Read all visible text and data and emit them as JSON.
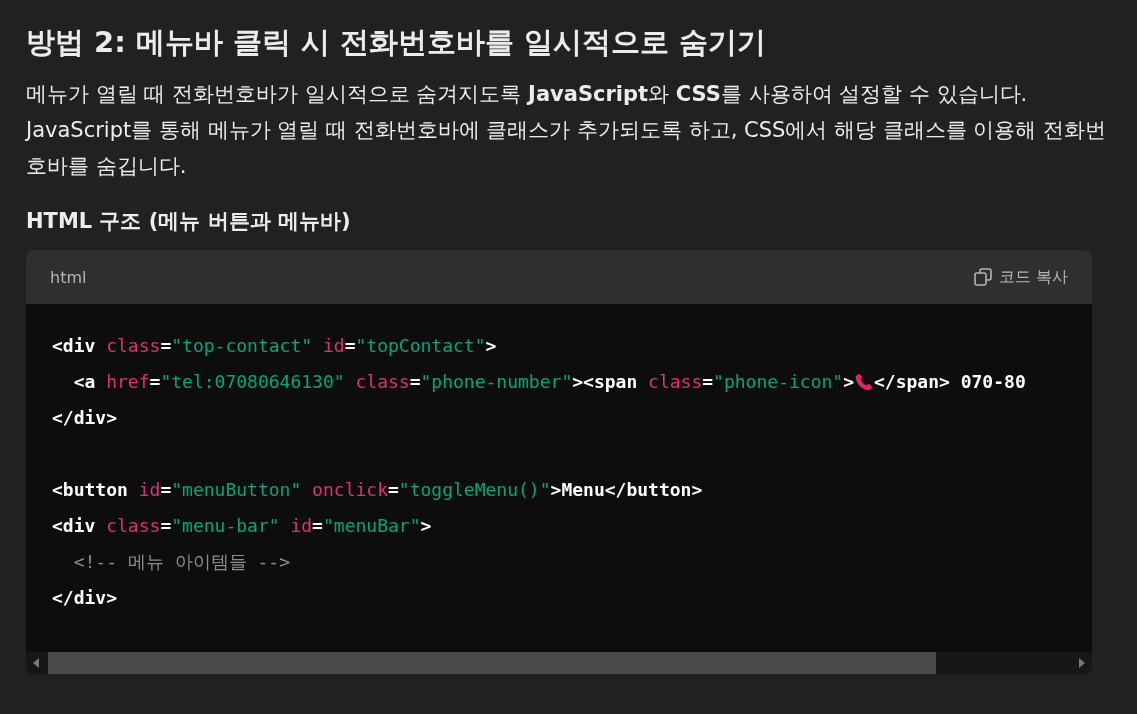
{
  "heading": "방법 2: 메뉴바 클릭 시 전화번호바를 일시적으로 숨기기",
  "paragraph": "메뉴가 열릴 때 전화번호바가 일시적으로 숨겨지도록 **JavaScript**와 **CSS**를 사용하여 설정할 수 있습니다. JavaScript를 통해 메뉴가 열릴 때 전화번호바에 클래스가 추가되도록 하고, CSS에서 해당 클래스를 이용해 전화번호바를 숨깁니다.",
  "subheading": "HTML 구조 (메뉴 버튼과 메뉴바)",
  "code_block": {
    "language": "html",
    "copy_label": "코드 복사",
    "lines": [
      {
        "kind": "code",
        "tokens": [
          {
            "kind": "tag",
            "text": "<div "
          },
          {
            "kind": "attr",
            "text": "class"
          },
          {
            "kind": "tag",
            "text": "="
          },
          {
            "kind": "str",
            "text": "\"top-contact\""
          },
          {
            "kind": "attr",
            "text": " id"
          },
          {
            "kind": "tag",
            "text": "="
          },
          {
            "kind": "str",
            "text": "\"topContact\""
          },
          {
            "kind": "tag",
            "text": ">"
          }
        ]
      },
      {
        "kind": "code",
        "tokens": [
          {
            "kind": "tag",
            "text": "  <a "
          },
          {
            "kind": "attr",
            "text": "href"
          },
          {
            "kind": "tag",
            "text": "="
          },
          {
            "kind": "str",
            "text": "\"tel:07080646130\""
          },
          {
            "kind": "attr",
            "text": " class"
          },
          {
            "kind": "tag",
            "text": "="
          },
          {
            "kind": "str",
            "text": "\"phone-number\""
          },
          {
            "kind": "tag",
            "text": "><span "
          },
          {
            "kind": "attr",
            "text": "class"
          },
          {
            "kind": "tag",
            "text": "="
          },
          {
            "kind": "str",
            "text": "\"phone-icon\""
          },
          {
            "kind": "tag",
            "text": ">"
          },
          {
            "kind": "icon"
          },
          {
            "kind": "tag",
            "text": "</span> 070-80"
          }
        ]
      },
      {
        "kind": "code",
        "tokens": [
          {
            "kind": "tag",
            "text": "</div>"
          }
        ]
      },
      {
        "kind": "blank"
      },
      {
        "kind": "code",
        "tokens": [
          {
            "kind": "tag",
            "text": "<button "
          },
          {
            "kind": "attr",
            "text": "id"
          },
          {
            "kind": "tag",
            "text": "="
          },
          {
            "kind": "str",
            "text": "\"menuButton\""
          },
          {
            "kind": "attr",
            "text": " onclick"
          },
          {
            "kind": "tag",
            "text": "="
          },
          {
            "kind": "str",
            "text": "\"toggleMenu()\""
          },
          {
            "kind": "tag",
            "text": ">Menu</button>"
          }
        ]
      },
      {
        "kind": "code",
        "tokens": [
          {
            "kind": "tag",
            "text": "<div "
          },
          {
            "kind": "attr",
            "text": "class"
          },
          {
            "kind": "tag",
            "text": "="
          },
          {
            "kind": "str",
            "text": "\"menu-bar\""
          },
          {
            "kind": "attr",
            "text": " id"
          },
          {
            "kind": "tag",
            "text": "="
          },
          {
            "kind": "str",
            "text": "\"menuBar\""
          },
          {
            "kind": "tag",
            "text": ">"
          }
        ]
      },
      {
        "kind": "code",
        "tokens": [
          {
            "kind": "comment",
            "text": "  <!-- 메뉴 아이템들 -->"
          }
        ]
      },
      {
        "kind": "code",
        "tokens": [
          {
            "kind": "tag",
            "text": "</div>"
          }
        ]
      }
    ]
  }
}
